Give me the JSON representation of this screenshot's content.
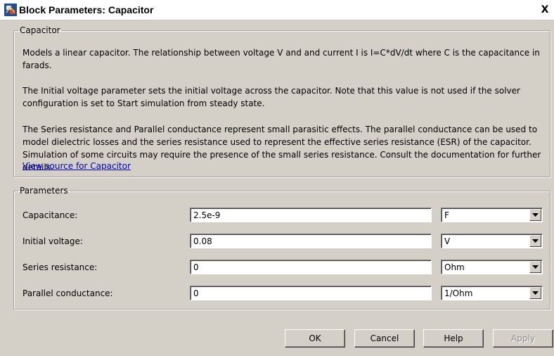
{
  "window": {
    "title": "Block Parameters: Capacitor",
    "close_glyph": "X"
  },
  "description": {
    "group_label": "Capacitor",
    "paragraphs": [
      "Models a linear capacitor. The relationship between voltage V and and current I is I=C*dV/dt where C is the capacitance in farads.",
      "The Initial voltage parameter sets the initial voltage across the capacitor. Note that this value is not used if the solver configuration is set to Start simulation from steady state.",
      "The Series resistance and Parallel conductance represent small parasitic effects. The parallel conductance can be used to model dielectric losses and the series resistance used to represent the effective series resistance (ESR) of the capacitor. Simulation of some circuits may require the presence of the small series resistance. Consult the documentation for further details."
    ],
    "link_text": "View source for Capacitor"
  },
  "parameters": {
    "group_label": "Parameters",
    "rows": [
      {
        "label": "Capacitance:",
        "value": "2.5e-9",
        "unit": "F"
      },
      {
        "label": "Initial voltage:",
        "value": "0.08",
        "unit": "V"
      },
      {
        "label": "Series resistance:",
        "value": "0",
        "unit": "Ohm"
      },
      {
        "label": "Parallel conductance:",
        "value": "0",
        "unit": "1/Ohm"
      }
    ]
  },
  "buttons": {
    "ok": "OK",
    "cancel": "Cancel",
    "help": "Help",
    "apply": "Apply"
  },
  "icons": {
    "app": "simulink-block-icon",
    "dropdown": "chevron-down-icon"
  }
}
